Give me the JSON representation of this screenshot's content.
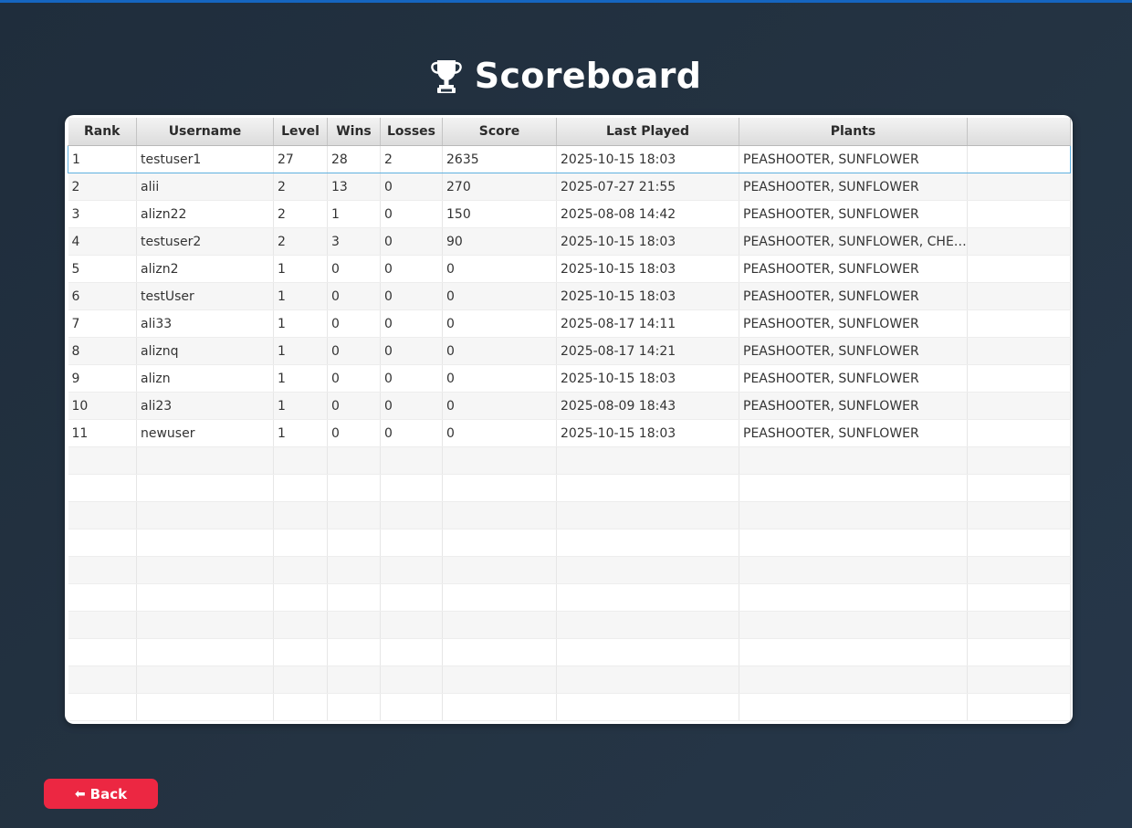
{
  "page": {
    "title": "Scoreboard",
    "title_icon": "trophy-icon"
  },
  "table": {
    "columns": [
      "Rank",
      "Username",
      "Level",
      "Wins",
      "Losses",
      "Score",
      "Last Played",
      "Plants",
      ""
    ],
    "rows": [
      [
        "1",
        "testuser1",
        "27",
        "28",
        "2",
        "2635",
        "2025-10-15 18:03",
        "PEASHOOTER, SUNFLOWER",
        ""
      ],
      [
        "2",
        "alii",
        "2",
        "13",
        "0",
        "270",
        "2025-07-27 21:55",
        "PEASHOOTER, SUNFLOWER",
        ""
      ],
      [
        "3",
        "alizn22",
        "2",
        "1",
        "0",
        "150",
        "2025-08-08 14:42",
        "PEASHOOTER, SUNFLOWER",
        ""
      ],
      [
        "4",
        "testuser2",
        "2",
        "3",
        "0",
        "90",
        "2025-10-15 18:03",
        "PEASHOOTER, SUNFLOWER, CHER...",
        ""
      ],
      [
        "5",
        "alizn2",
        "1",
        "0",
        "0",
        "0",
        "2025-10-15 18:03",
        "PEASHOOTER, SUNFLOWER",
        ""
      ],
      [
        "6",
        "testUser",
        "1",
        "0",
        "0",
        "0",
        "2025-10-15 18:03",
        "PEASHOOTER, SUNFLOWER",
        ""
      ],
      [
        "7",
        "ali33",
        "1",
        "0",
        "0",
        "0",
        "2025-08-17 14:11",
        "PEASHOOTER, SUNFLOWER",
        ""
      ],
      [
        "8",
        "aliznq",
        "1",
        "0",
        "0",
        "0",
        "2025-08-17 14:21",
        "PEASHOOTER, SUNFLOWER",
        ""
      ],
      [
        "9",
        "alizn",
        "1",
        "0",
        "0",
        "0",
        "2025-10-15 18:03",
        "PEASHOOTER, SUNFLOWER",
        ""
      ],
      [
        "10",
        "ali23",
        "1",
        "0",
        "0",
        "0",
        "2025-08-09 18:43",
        "PEASHOOTER, SUNFLOWER",
        ""
      ],
      [
        "11",
        "newuser",
        "1",
        "0",
        "0",
        "0",
        "2025-10-15 18:03",
        "PEASHOOTER, SUNFLOWER",
        ""
      ]
    ],
    "selected_row": 0
  },
  "back_button": {
    "label": "Back",
    "icon": "left-arrow-icon"
  },
  "colors": {
    "background": "#243342",
    "accent_bar": "#1565c0",
    "back_button": "#ec2742",
    "selection": "#5fb0e0"
  }
}
